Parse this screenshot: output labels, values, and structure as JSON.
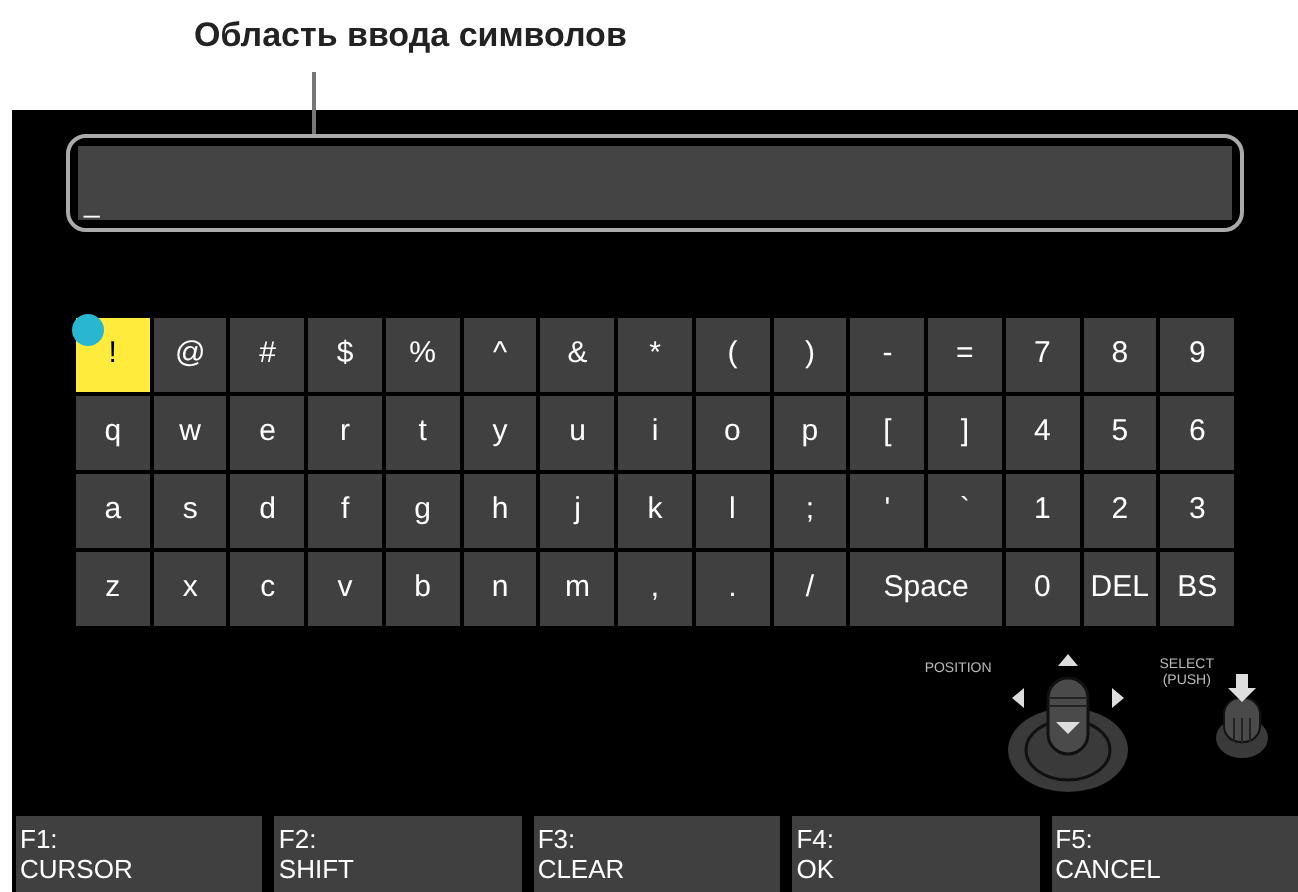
{
  "caption": "Область ввода символов",
  "input": {
    "value": "_"
  },
  "keyboard": [
    [
      {
        "label": "!",
        "selected": true,
        "kind": "normal"
      },
      {
        "label": "@",
        "selected": false,
        "kind": "normal"
      },
      {
        "label": "#",
        "selected": false,
        "kind": "normal"
      },
      {
        "label": "$",
        "selected": false,
        "kind": "normal"
      },
      {
        "label": "%",
        "selected": false,
        "kind": "normal"
      },
      {
        "label": "^",
        "selected": false,
        "kind": "normal"
      },
      {
        "label": "&",
        "selected": false,
        "kind": "normal"
      },
      {
        "label": "*",
        "selected": false,
        "kind": "normal"
      },
      {
        "label": "(",
        "selected": false,
        "kind": "normal"
      },
      {
        "label": ")",
        "selected": false,
        "kind": "normal"
      },
      {
        "label": "-",
        "selected": false,
        "kind": "normal"
      },
      {
        "label": "=",
        "selected": false,
        "kind": "normal"
      },
      {
        "label": "7",
        "selected": false,
        "kind": "normal"
      },
      {
        "label": "8",
        "selected": false,
        "kind": "normal"
      },
      {
        "label": "9",
        "selected": false,
        "kind": "normal"
      }
    ],
    [
      {
        "label": "q",
        "selected": false,
        "kind": "normal"
      },
      {
        "label": "w",
        "selected": false,
        "kind": "normal"
      },
      {
        "label": "e",
        "selected": false,
        "kind": "normal"
      },
      {
        "label": "r",
        "selected": false,
        "kind": "normal"
      },
      {
        "label": "t",
        "selected": false,
        "kind": "normal"
      },
      {
        "label": "y",
        "selected": false,
        "kind": "normal"
      },
      {
        "label": "u",
        "selected": false,
        "kind": "normal"
      },
      {
        "label": "i",
        "selected": false,
        "kind": "normal"
      },
      {
        "label": "o",
        "selected": false,
        "kind": "normal"
      },
      {
        "label": "p",
        "selected": false,
        "kind": "normal"
      },
      {
        "label": "[",
        "selected": false,
        "kind": "normal"
      },
      {
        "label": "]",
        "selected": false,
        "kind": "normal"
      },
      {
        "label": "4",
        "selected": false,
        "kind": "normal"
      },
      {
        "label": "5",
        "selected": false,
        "kind": "normal"
      },
      {
        "label": "6",
        "selected": false,
        "kind": "normal"
      }
    ],
    [
      {
        "label": "a",
        "selected": false,
        "kind": "normal"
      },
      {
        "label": "s",
        "selected": false,
        "kind": "normal"
      },
      {
        "label": "d",
        "selected": false,
        "kind": "normal"
      },
      {
        "label": "f",
        "selected": false,
        "kind": "normal"
      },
      {
        "label": "g",
        "selected": false,
        "kind": "normal"
      },
      {
        "label": "h",
        "selected": false,
        "kind": "normal"
      },
      {
        "label": "j",
        "selected": false,
        "kind": "normal"
      },
      {
        "label": "k",
        "selected": false,
        "kind": "normal"
      },
      {
        "label": "l",
        "selected": false,
        "kind": "normal"
      },
      {
        "label": ";",
        "selected": false,
        "kind": "normal"
      },
      {
        "label": "'",
        "selected": false,
        "kind": "normal"
      },
      {
        "label": "`",
        "selected": false,
        "kind": "normal"
      },
      {
        "label": "1",
        "selected": false,
        "kind": "normal"
      },
      {
        "label": "2",
        "selected": false,
        "kind": "normal"
      },
      {
        "label": "3",
        "selected": false,
        "kind": "normal"
      }
    ],
    [
      {
        "label": "z",
        "selected": false,
        "kind": "normal"
      },
      {
        "label": "x",
        "selected": false,
        "kind": "normal"
      },
      {
        "label": "c",
        "selected": false,
        "kind": "normal"
      },
      {
        "label": "v",
        "selected": false,
        "kind": "normal"
      },
      {
        "label": "b",
        "selected": false,
        "kind": "normal"
      },
      {
        "label": "n",
        "selected": false,
        "kind": "normal"
      },
      {
        "label": "m",
        "selected": false,
        "kind": "normal"
      },
      {
        "label": ",",
        "selected": false,
        "kind": "normal"
      },
      {
        "label": ".",
        "selected": false,
        "kind": "normal"
      },
      {
        "label": "/",
        "selected": false,
        "kind": "normal"
      },
      {
        "label": "Space",
        "selected": false,
        "kind": "wide"
      },
      {
        "label": "0",
        "selected": false,
        "kind": "normal"
      },
      {
        "label": "DEL",
        "selected": false,
        "kind": "normal"
      },
      {
        "label": "BS",
        "selected": false,
        "kind": "normal"
      }
    ]
  ],
  "controls": {
    "position_label": "POSITION",
    "select_label": "SELECT",
    "select_sub_label": "(PUSH)"
  },
  "function_keys": [
    {
      "key": "F1:",
      "action": "CURSOR"
    },
    {
      "key": "F2:",
      "action": "SHIFT"
    },
    {
      "key": "F3:",
      "action": "CLEAR"
    },
    {
      "key": "F4:",
      "action": "OK"
    },
    {
      "key": "F5:",
      "action": "CANCEL"
    }
  ]
}
